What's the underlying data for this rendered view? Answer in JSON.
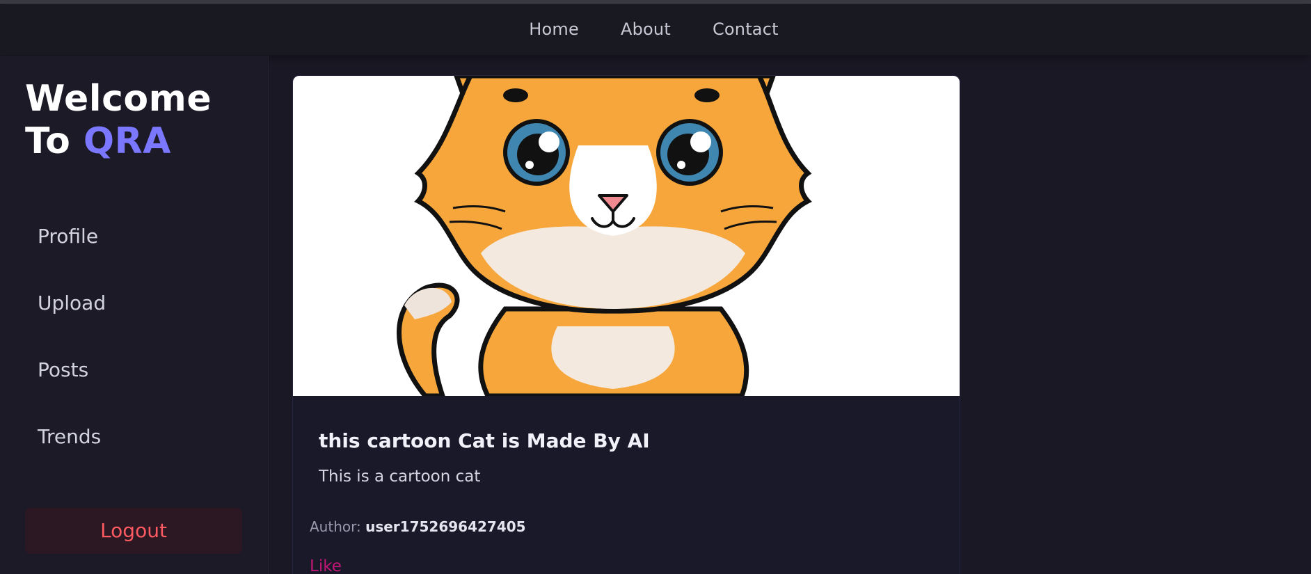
{
  "nav": {
    "home": "Home",
    "about": "About",
    "contact": "Contact"
  },
  "brand": {
    "line1": "Welcome",
    "line2_prefix": "To ",
    "line2_accent": "QRA"
  },
  "sidebar": {
    "items": [
      {
        "label": "Profile"
      },
      {
        "label": "Upload"
      },
      {
        "label": "Posts"
      },
      {
        "label": "Trends"
      }
    ],
    "logout": "Logout"
  },
  "post": {
    "title": "this cartoon Cat is Made By AI",
    "description": "This is a cartoon cat",
    "author_label": "Author:",
    "author": "user1752696427405",
    "like": "Like"
  },
  "colors": {
    "accent": "#7b78ff",
    "logout": "#ff5a61",
    "like": "#c01675"
  }
}
